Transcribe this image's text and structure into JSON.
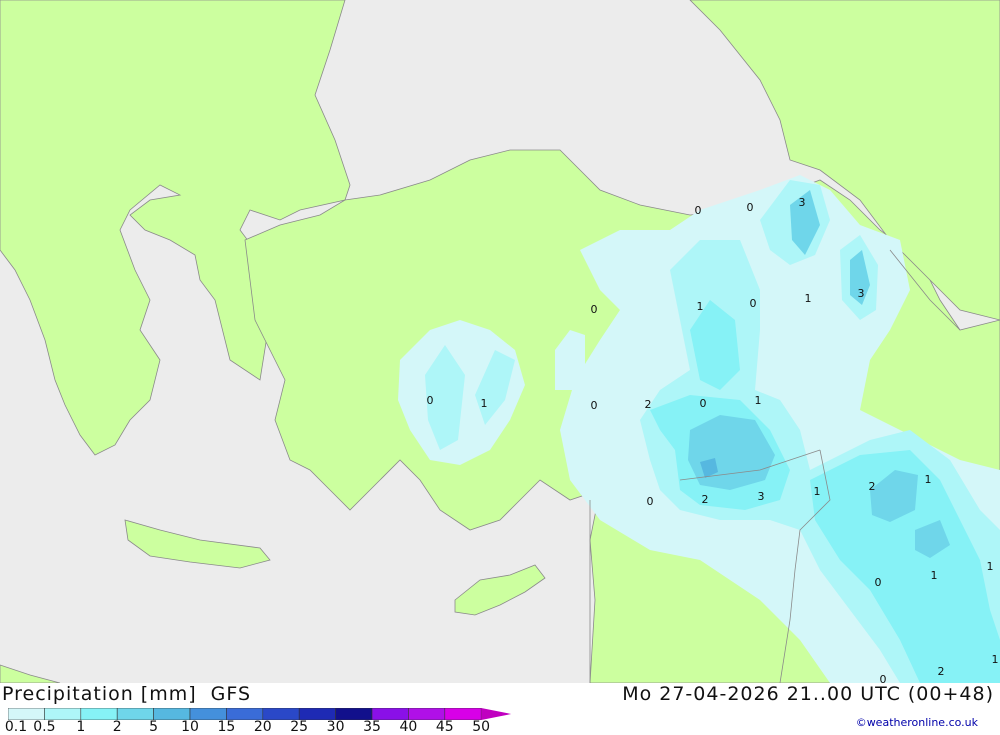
{
  "header": {
    "title": "Precipitation [mm]",
    "model": "GFS",
    "datetime": "Mo 27-04-2026 21..00 UTC (00+48)",
    "credit": "©weatheronline.co.uk"
  },
  "legend": {
    "ticks": [
      "0.1",
      "0.5",
      "1",
      "2",
      "5",
      "10",
      "15",
      "20",
      "25",
      "30",
      "35",
      "40",
      "45",
      "50"
    ],
    "colors": [
      "#d4f7f9",
      "#aef6f8",
      "#86f2f6",
      "#6fd6ea",
      "#56b8e0",
      "#4490dc",
      "#3a6cd8",
      "#2a48c8",
      "#1e2ab4",
      "#12108c",
      "#8a10e8",
      "#b010e8",
      "#d800e8",
      "#c000c0",
      "#a000b0"
    ]
  },
  "map_labels": [
    "0",
    "0",
    "3",
    "0",
    "1",
    "0",
    "1",
    "3",
    "0",
    "1",
    "0",
    "1",
    "2",
    "0",
    "1",
    "2",
    "3",
    "1",
    "2",
    "1",
    "0",
    "0",
    "1",
    "0",
    "1",
    "2"
  ],
  "colors": {
    "sea": "#ececec",
    "land": "#ccff9f",
    "border": "#999999"
  }
}
